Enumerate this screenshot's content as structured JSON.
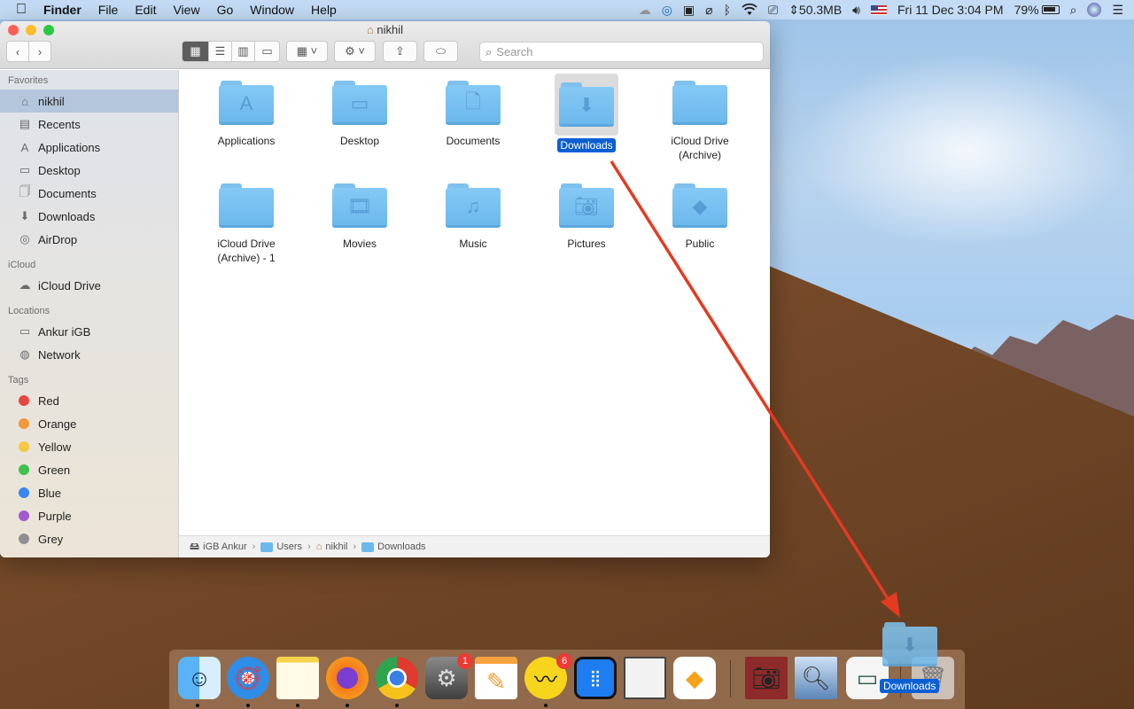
{
  "menubar": {
    "apple": "",
    "app_name": "Finder",
    "items": [
      "File",
      "Edit",
      "View",
      "Go",
      "Window",
      "Help"
    ],
    "status": {
      "network_speed": "⇕50.3MB",
      "datetime": "Fri 11 Dec  3:04 PM",
      "battery": "79%"
    }
  },
  "window": {
    "title": "nikhil",
    "search_placeholder": "Search"
  },
  "sidebar": {
    "sections": [
      {
        "header": "Favorites",
        "items": [
          {
            "label": "nikhil",
            "icon": "home-icon",
            "selected": true
          },
          {
            "label": "Recents",
            "icon": "recents-icon"
          },
          {
            "label": "Applications",
            "icon": "applications-icon"
          },
          {
            "label": "Desktop",
            "icon": "desktop-icon"
          },
          {
            "label": "Documents",
            "icon": "documents-icon"
          },
          {
            "label": "Downloads",
            "icon": "downloads-icon"
          },
          {
            "label": "AirDrop",
            "icon": "airdrop-icon"
          }
        ]
      },
      {
        "header": "iCloud",
        "items": [
          {
            "label": "iCloud Drive",
            "icon": "cloud-icon"
          }
        ]
      },
      {
        "header": "Locations",
        "items": [
          {
            "label": "Ankur iGB",
            "icon": "laptop-icon"
          },
          {
            "label": "Network",
            "icon": "network-icon"
          }
        ]
      },
      {
        "header": "Tags",
        "items": [
          {
            "label": "Red",
            "color": "#e8473f"
          },
          {
            "label": "Orange",
            "color": "#f2973a"
          },
          {
            "label": "Yellow",
            "color": "#f5c842"
          },
          {
            "label": "Green",
            "color": "#3fc050"
          },
          {
            "label": "Blue",
            "color": "#3a86f0"
          },
          {
            "label": "Purple",
            "color": "#a25ad2"
          },
          {
            "label": "Grey",
            "color": "#8e8e93"
          }
        ]
      }
    ]
  },
  "files": [
    {
      "name": "Applications",
      "glyph": "applications"
    },
    {
      "name": "Desktop",
      "glyph": "desktop"
    },
    {
      "name": "Documents",
      "glyph": "documents"
    },
    {
      "name": "Downloads",
      "glyph": "downloads",
      "selected": true
    },
    {
      "name": "iCloud Drive (Archive)",
      "glyph": "none"
    },
    {
      "name": "iCloud Drive (Archive) - 1",
      "glyph": "none"
    },
    {
      "name": "Movies",
      "glyph": "movies"
    },
    {
      "name": "Music",
      "glyph": "music"
    },
    {
      "name": "Pictures",
      "glyph": "pictures"
    },
    {
      "name": "Public",
      "glyph": "public"
    }
  ],
  "pathbar": [
    "iGB Ankur",
    "Users",
    "nikhil",
    "Downloads"
  ],
  "dock": {
    "apps": [
      {
        "name": "Finder",
        "running": true
      },
      {
        "name": "Safari",
        "running": true
      },
      {
        "name": "Notes",
        "running": true
      },
      {
        "name": "Firefox",
        "running": true
      },
      {
        "name": "Chrome",
        "running": true
      },
      {
        "name": "System Preferences",
        "badge": "1"
      },
      {
        "name": "Pages"
      },
      {
        "name": "Basecamp",
        "badge": "6",
        "running": true
      },
      {
        "name": "Tweetbot"
      },
      {
        "name": "LibreOffice"
      },
      {
        "name": "Sketch"
      },
      {
        "name": "Photo Booth"
      },
      {
        "name": "Preview"
      },
      {
        "name": "Disk Utility"
      },
      {
        "name": "Trash"
      }
    ],
    "drag_label": "Downloads"
  },
  "colors": {
    "selection": "#0b5fd3",
    "folder": "#7fc1ee",
    "arrow": "#e53a22"
  }
}
